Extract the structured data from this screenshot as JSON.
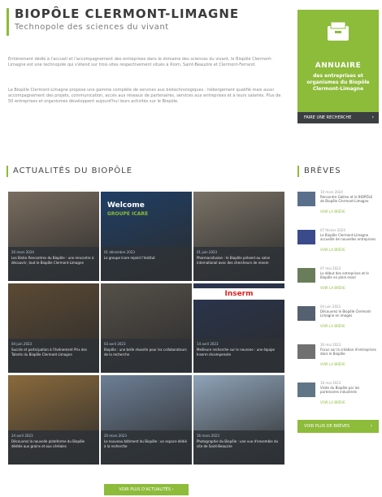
{
  "header": {
    "title": "BIOPÔLE CLERMONT-LIMAGNE",
    "subtitle": "Technopole des sciences du vivant"
  },
  "intro": {
    "p1": "Entièrement dédié à l'accueil et l'accompagnement des entreprises dans le domaine des sciences du vivant, le Biopôle Clermont-Limagne est une technopole qui s'étend sur trois sites respectivement situés à Riom, Saint-Beauzire et Clermont-Ferrand.",
    "p2": "Le Biopôle Clermont-Limagne propose une gamme complète de services aux biotechnologiques : hébergement qualifié mais aussi accompagnement des projets, communication, accès aux réseaux de partenaires, services aux entreprises et à leurs salariés. Plus de 50 entreprises et organismes développent aujourd'hui leurs activités sur le Biopôle."
  },
  "annuaire": {
    "title": "ANNUAIRE",
    "desc": "des entreprises et organismes du Biopôle Clermont-Limagne",
    "button": "FAIRE UNE RECHERCHE",
    "icon": "folder-icon"
  },
  "actualites": {
    "title": "ACTUALITÉS DU BIOPÔLE",
    "more_button": "VOIR PLUS D'ACTUALITÉS",
    "tiles": [
      {
        "date": "20 mars 2024",
        "text": "Les Bistro Rencontres du Biopôle : une rencontre à découvrir, tout le Biopôle Clermont-Limagne",
        "color": "#7a6d5f"
      },
      {
        "date": "01 décembre 2023",
        "text": "Le groupe Icare rejoint l'Institut",
        "color": "#1f3f66",
        "overlay": "Welcome",
        "overlay2": "GROUPE ICARE"
      },
      {
        "date": "01 juin 2023",
        "text": "Pharmacofusion : le Biopôle présent au salon international avec des chercheurs de renom",
        "color": "#7a7266"
      },
      {
        "date": "04 juin 2023",
        "text": "Succès et participation à l'événement Prix des Talents du Biopôle Clermont-Limagne",
        "color": "#5c4a34"
      },
      {
        "date": "03 avril 2023",
        "text": "Biopôle : une belle réussite pour les collaborateurs de la recherche",
        "color": "#555049"
      },
      {
        "date": "14 avril 2023",
        "text": "Meilleure recherche sur le neurone : une équipe Inserm récompensée",
        "color": "#2a3550",
        "overlay": "Inserm"
      },
      {
        "date": "24 avril 2023",
        "text": "Découvrez la nouvelle plateforme du Biopôle dédiée aux grains et aux céréales",
        "color": "#8a6a3c"
      },
      {
        "date": "20 mars 2023",
        "text": "Le nouveau bâtiment du Biopôle : un espace dédié à la recherche",
        "color": "#6d7f96"
      },
      {
        "date": "16 mars 2023",
        "text": "Photographie du Biopôle : une vue d'ensemble du site de Saint-Beauzire",
        "color": "#8fa3b8"
      }
    ]
  },
  "breves": {
    "title": "BRÈVES",
    "more_button": "VOIR PLUS DE BRÈVES",
    "items": [
      {
        "date": "10 mars 2024",
        "text": "Rencontre Galileo et le BIOPÔLE de Biopôle Clermont-Limagne",
        "link": "VOIR LA BRÈVE"
      },
      {
        "date": "07 février 2024",
        "text": "Le Biopôle Clermont-Limagne accueille de nouvelles entreprises",
        "link": "VOIR LA BRÈVE"
      },
      {
        "date": "07 mai 2023",
        "text": "Le début des entreprises et le Biopôle en plein essor",
        "link": "VOIR LA BRÈVE"
      },
      {
        "date": "04 juin 2023",
        "text": "Découvrez le Biopôle Clermont-Limagne en images",
        "link": "VOIR LA BRÈVE"
      },
      {
        "date": "30 mai 2023",
        "text": "Focus sur la création d'entreprises dans le Biopôle",
        "link": "VOIR LA BRÈVE"
      },
      {
        "date": "16 mai 2023",
        "text": "Visite du Biopôle par les partenaires industriels",
        "link": "VOIR LA BRÈVE"
      }
    ]
  }
}
